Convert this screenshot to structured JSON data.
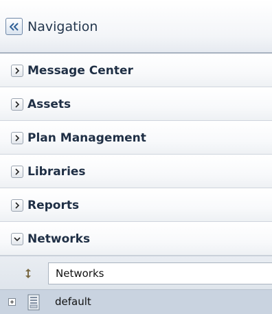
{
  "header": {
    "title": "Navigation",
    "collapse_icon": "double-chevron-left-icon"
  },
  "accordion": {
    "items": [
      {
        "label": "Message Center",
        "state": "collapsed"
      },
      {
        "label": "Assets",
        "state": "collapsed"
      },
      {
        "label": "Plan Management",
        "state": "collapsed"
      },
      {
        "label": "Libraries",
        "state": "collapsed"
      },
      {
        "label": "Reports",
        "state": "collapsed"
      },
      {
        "label": "Networks",
        "state": "expanded"
      }
    ]
  },
  "networks": {
    "refresh_icon": "refresh-icon",
    "selected_view": "Networks",
    "tree": [
      {
        "label": "default",
        "icon": "server-icon",
        "expand_icon": "plus-box-icon"
      }
    ]
  },
  "colors": {
    "accent": "#3b6aa0",
    "text": "#1f2f45",
    "selected_row": "#c9d3e0"
  }
}
